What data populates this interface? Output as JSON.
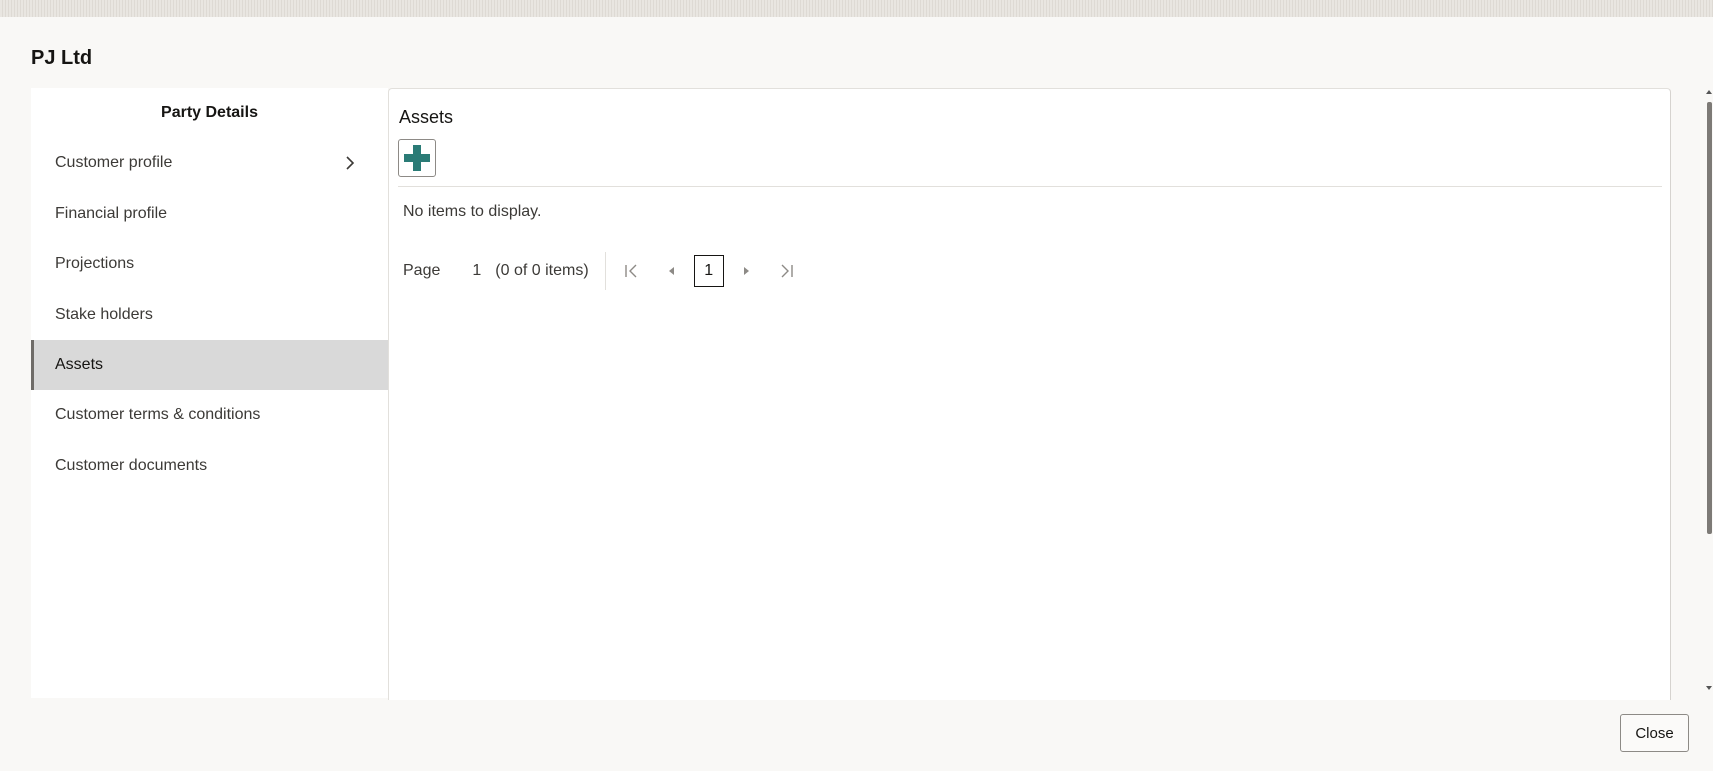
{
  "dialog": {
    "title": "PJ Ltd"
  },
  "sidebar": {
    "heading": "Party Details",
    "items": [
      {
        "label": "Customer profile"
      },
      {
        "label": "Financial profile"
      },
      {
        "label": "Projections"
      },
      {
        "label": "Stake holders"
      },
      {
        "label": "Assets"
      },
      {
        "label": "Customer terms & conditions"
      },
      {
        "label": "Customer documents"
      }
    ],
    "active_item": "Assets"
  },
  "main": {
    "title": "Assets",
    "empty_text": "No items to display.",
    "pager": {
      "page_label": "Page",
      "page_value": "1",
      "item_count": "(0 of 0 items)",
      "current_page": "1"
    }
  },
  "footer": {
    "close_label": "Close"
  },
  "colors": {
    "accent": "#2a7b76",
    "active_bg": "#d9d9d9"
  },
  "icons": {
    "add": "plus-icon",
    "expand": "chevron-right-icon",
    "first": "first-page-icon",
    "prev": "previous-page-icon",
    "next": "next-page-icon",
    "last": "last-page-icon"
  }
}
